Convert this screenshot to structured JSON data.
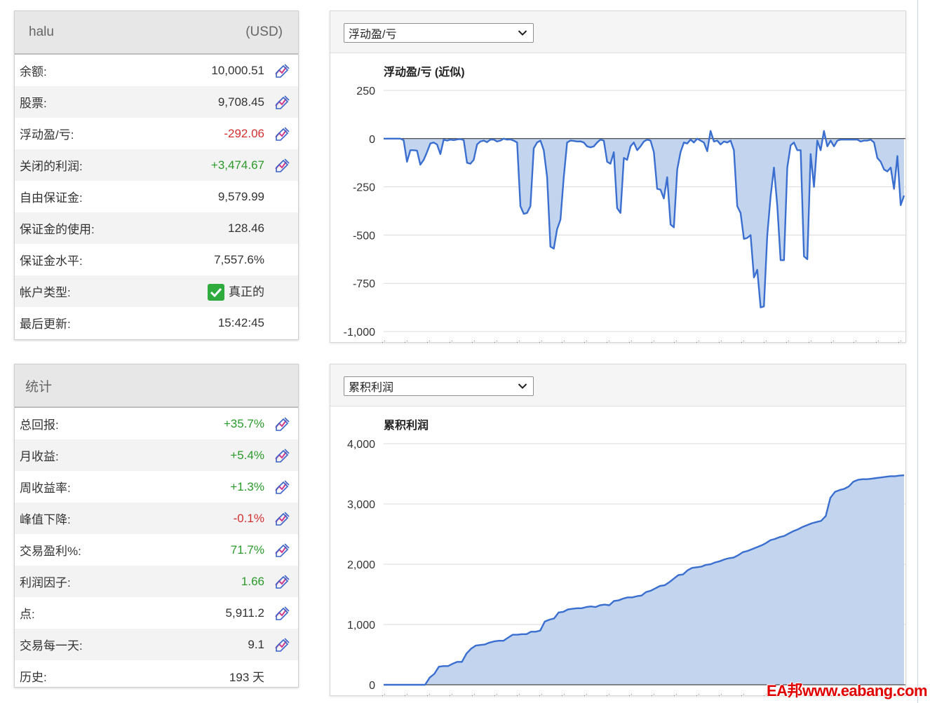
{
  "account": {
    "name": "halu",
    "currency": "(USD)",
    "rows": [
      {
        "label": "余额:",
        "value": "10,000.51",
        "tone": "",
        "icon": "chart-edit-icon"
      },
      {
        "label": "股票:",
        "value": "9,708.45",
        "tone": "",
        "icon": "chart-edit-icon"
      },
      {
        "label": "浮动盈/亏:",
        "value": "-292.06",
        "tone": "neg",
        "icon": "chart-edit-icon"
      },
      {
        "label": "关闭的利润:",
        "value": "+3,474.67",
        "tone": "pos",
        "icon": "chart-edit-icon"
      },
      {
        "label": "自由保证金:",
        "value": "9,579.99",
        "tone": "",
        "icon": ""
      },
      {
        "label": "保证金的使用:",
        "value": "128.46",
        "tone": "",
        "icon": ""
      },
      {
        "label": "保证金水平:",
        "value": "7,557.6%",
        "tone": "",
        "icon": ""
      },
      {
        "label": "帐户类型:",
        "value": "真正的",
        "tone": "",
        "icon": "",
        "check": true
      },
      {
        "label": "最后更新:",
        "value": "15:42:45",
        "tone": "",
        "icon": ""
      }
    ]
  },
  "stats": {
    "title": "统计",
    "rows": [
      {
        "label": "总回报:",
        "value": "+35.7%",
        "tone": "pos",
        "icon": "chart-edit-icon"
      },
      {
        "label": "月收益:",
        "value": "+5.4%",
        "tone": "pos",
        "icon": "chart-edit-icon"
      },
      {
        "label": "周收益率:",
        "value": "+1.3%",
        "tone": "pos",
        "icon": "chart-edit-icon"
      },
      {
        "label": "峰值下降:",
        "value": "-0.1%",
        "tone": "neg",
        "icon": "chart-edit-icon"
      },
      {
        "label": "交易盈利%:",
        "value": "71.7%",
        "tone": "pos",
        "icon": "chart-edit-icon"
      },
      {
        "label": "利润因子:",
        "value": "1.66",
        "tone": "pos",
        "icon": "chart-edit-icon"
      },
      {
        "label": "点:",
        "value": "5,911.2",
        "tone": "",
        "icon": "chart-edit-icon"
      },
      {
        "label": "交易每一天:",
        "value": "9.1",
        "tone": "",
        "icon": "chart-edit-icon"
      },
      {
        "label": "历史:",
        "value": "193 天",
        "tone": "",
        "icon": ""
      }
    ]
  },
  "chart1": {
    "dropdown_value": "浮动盈/亏",
    "chart_data": {
      "type": "area",
      "title": "浮动盈/亏 (近似)",
      "xlabel": "",
      "ylabel": "",
      "ylim": [
        -1000,
        250
      ],
      "yticks": [
        250,
        0,
        -250,
        -500,
        -750,
        -1000
      ],
      "ytick_labels": [
        "250",
        "0",
        "-250",
        "-500",
        "-750",
        "-1,000"
      ],
      "x_tick_count": 24,
      "grid": true,
      "line_color": "#3a6fd0",
      "fill_color": "#c3d4ef",
      "values": [
        0,
        0,
        0,
        0,
        0,
        0,
        -8,
        -120,
        -60,
        -60,
        -62,
        -135,
        -110,
        -70,
        -25,
        -20,
        -30,
        -80,
        -5,
        -10,
        -5,
        -8,
        -4,
        -2,
        -8,
        -125,
        -130,
        -110,
        -30,
        -15,
        -10,
        -18,
        -5,
        -5,
        -15,
        -10,
        0,
        -5,
        -4,
        -10,
        -20,
        -350,
        -390,
        -385,
        -350,
        -50,
        -20,
        -10,
        -60,
        -200,
        -560,
        -570,
        -470,
        -420,
        -200,
        -20,
        -10,
        -12,
        -15,
        -14,
        -20,
        -40,
        -45,
        -40,
        -20,
        -5,
        -10,
        -120,
        -130,
        -70,
        -360,
        -385,
        -100,
        -110,
        -40,
        -20,
        -60,
        -40,
        -15,
        -5,
        -10,
        -70,
        -260,
        -265,
        -310,
        -200,
        -445,
        -460,
        -160,
        -70,
        -20,
        -25,
        -5,
        -20,
        0,
        -10,
        -20,
        -65,
        40,
        -15,
        -10,
        -30,
        -15,
        -20,
        -10,
        -60,
        -350,
        -385,
        -520,
        -515,
        -500,
        -720,
        -680,
        -875,
        -870,
        -500,
        -300,
        -150,
        -350,
        -630,
        -630,
        -150,
        -35,
        -20,
        -60,
        -60,
        -610,
        -625,
        -80,
        -250,
        -10,
        -60,
        40,
        -40,
        -10,
        -40,
        -10,
        -5,
        -5,
        -5,
        -5,
        -5,
        -5,
        -15,
        -10,
        -10,
        -5,
        -20,
        -100,
        -120,
        -160,
        -170,
        -150,
        -260,
        -90,
        -345,
        -295
      ]
    }
  },
  "chart2": {
    "dropdown_value": "累积利润",
    "chart_data": {
      "type": "area",
      "title": "累积利润",
      "xlabel": "",
      "ylabel": "",
      "ylim": [
        0,
        4000
      ],
      "yticks": [
        0,
        1000,
        2000,
        3000,
        4000
      ],
      "ytick_labels": [
        "0",
        "1,000",
        "2,000",
        "3,000",
        "4,000"
      ],
      "x_tick_count": 24,
      "grid": true,
      "line_color": "#3a6fd0",
      "fill_color": "#c3d4ef",
      "values": [
        0,
        0,
        0,
        0,
        0,
        0,
        0,
        0,
        0,
        0,
        120,
        180,
        300,
        310,
        310,
        350,
        380,
        380,
        520,
        600,
        650,
        660,
        670,
        700,
        720,
        730,
        730,
        780,
        830,
        830,
        840,
        840,
        880,
        880,
        900,
        1050,
        1080,
        1100,
        1200,
        1210,
        1250,
        1260,
        1270,
        1270,
        1290,
        1300,
        1290,
        1320,
        1330,
        1320,
        1390,
        1400,
        1430,
        1450,
        1450,
        1470,
        1480,
        1540,
        1560,
        1600,
        1640,
        1650,
        1700,
        1760,
        1820,
        1830,
        1900,
        1940,
        1950,
        1960,
        1990,
        2000,
        2030,
        2050,
        2080,
        2100,
        2110,
        2150,
        2200,
        2220,
        2250,
        2280,
        2310,
        2350,
        2400,
        2420,
        2450,
        2470,
        2510,
        2550,
        2580,
        2620,
        2650,
        2680,
        2700,
        2720,
        2800,
        3100,
        3200,
        3230,
        3250,
        3290,
        3370,
        3400,
        3410,
        3410,
        3420,
        3430,
        3440,
        3450,
        3460,
        3460,
        3470,
        3475
      ]
    }
  },
  "watermark": "EA邦www.eabang.com"
}
